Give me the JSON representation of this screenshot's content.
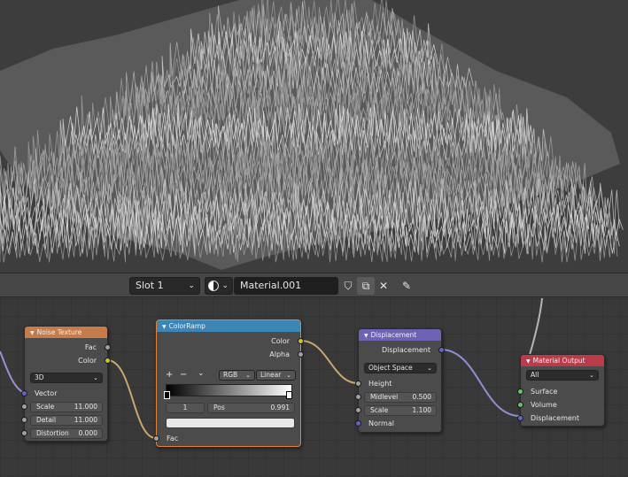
{
  "header": {
    "slot": "Slot 1",
    "material_name": "Material.001"
  },
  "nodes": {
    "noise": {
      "title": "Noise Texture",
      "out_fac": "Fac",
      "out_color": "Color",
      "dimension": "3D",
      "in_vector": "Vector",
      "scale_label": "Scale",
      "scale_value": "11.000",
      "detail_label": "Detail",
      "detail_value": "11.000",
      "distortion_label": "Distortion",
      "distortion_value": "0.000"
    },
    "ramp": {
      "title": "ColorRamp",
      "out_color": "Color",
      "out_alpha": "Alpha",
      "plus": "+",
      "minus": "−",
      "mode": "RGB",
      "interp": "Linear",
      "stop_index": "1",
      "pos_label": "Pos",
      "pos_value": "0.991",
      "in_fac": "Fac"
    },
    "disp": {
      "title": "Displacement",
      "out_disp": "Displacement",
      "space": "Object Space",
      "in_height": "Height",
      "midlevel_label": "Midlevel",
      "midlevel_value": "0.500",
      "scale_label": "Scale",
      "scale_value": "1.100",
      "in_normal": "Normal"
    },
    "output": {
      "title": "Material Output",
      "target": "All",
      "in_surface": "Surface",
      "in_volume": "Volume",
      "in_disp": "Displacement"
    }
  },
  "colors": {
    "texture_header": "#c57b4a",
    "converter_header": "#3c86b7",
    "vector_header": "#6c63b5",
    "output_header": "#b83c4a",
    "selected_outline": "#e0843c"
  }
}
